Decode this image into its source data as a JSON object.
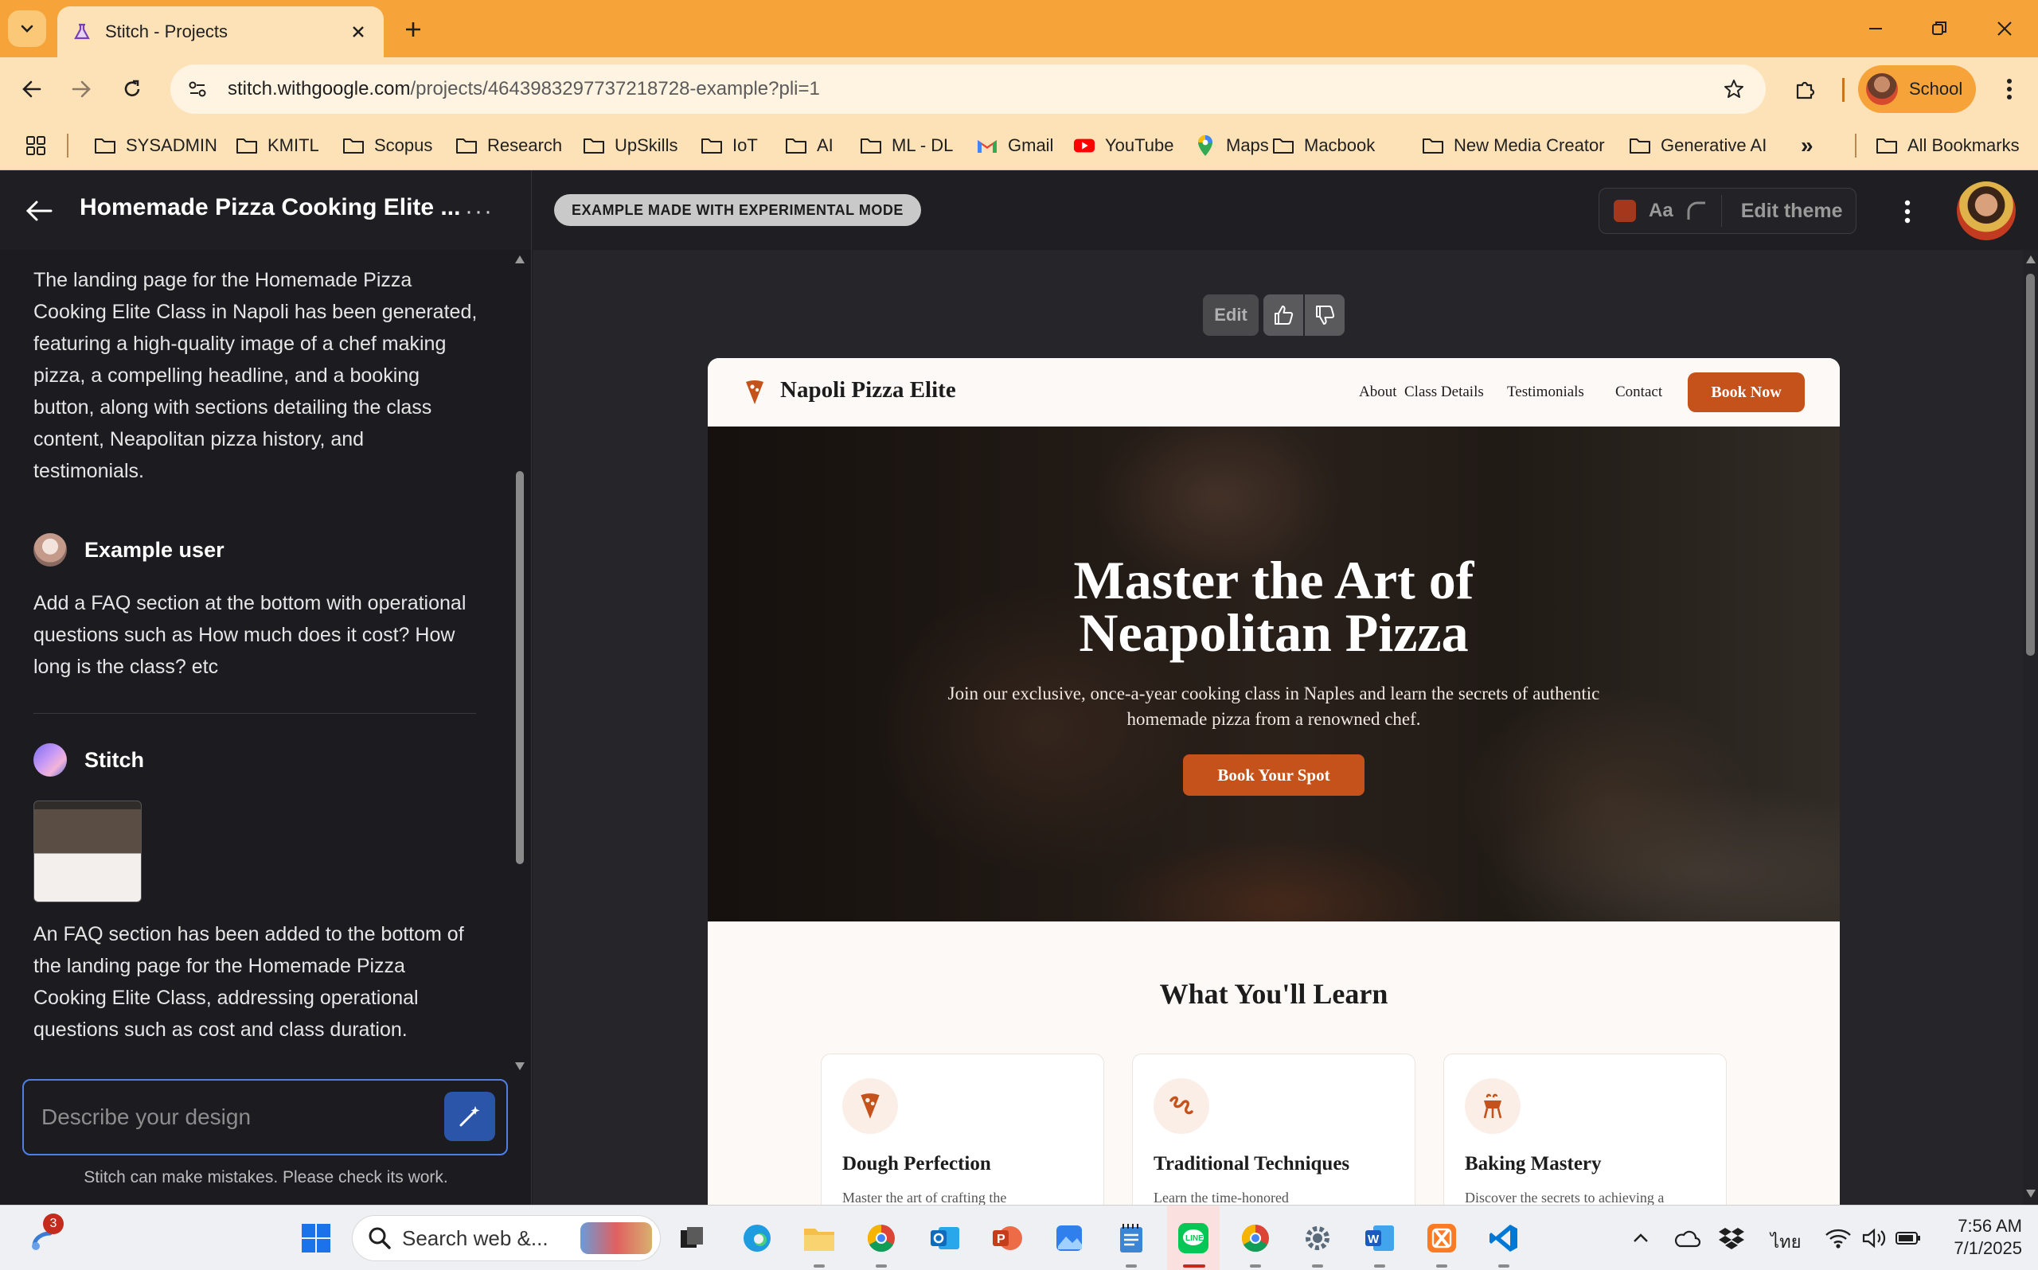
{
  "browser": {
    "tab_title": "Stitch - Projects",
    "url_host": "stitch.withgoogle.com",
    "url_path": "/projects/4643983297737218728-example?pli=1",
    "profile_label": "School",
    "bookmarks": [
      {
        "label": "SYSADMIN",
        "icon": "folder-icon"
      },
      {
        "label": "KMITL",
        "icon": "folder-icon"
      },
      {
        "label": "Scopus",
        "icon": "folder-icon"
      },
      {
        "label": "Research",
        "icon": "folder-icon"
      },
      {
        "label": "UpSkills",
        "icon": "folder-icon"
      },
      {
        "label": "IoT",
        "icon": "folder-icon"
      },
      {
        "label": "AI",
        "icon": "folder-icon"
      },
      {
        "label": "ML - DL",
        "icon": "folder-icon"
      },
      {
        "label": "Gmail",
        "icon": "gmail-icon"
      },
      {
        "label": "YouTube",
        "icon": "youtube-icon"
      },
      {
        "label": "Maps",
        "icon": "maps-icon"
      },
      {
        "label": "Macbook",
        "icon": "folder-icon"
      },
      {
        "label": "New Media Creator",
        "icon": "folder-icon"
      },
      {
        "label": "Generative AI",
        "icon": "folder-icon"
      }
    ],
    "all_bookmarks": "All Bookmarks",
    "overflow": "»"
  },
  "app": {
    "project_title": "Homemade Pizza Cooking Elite ...",
    "more_label": "···",
    "mode_pill": "EXAMPLE MADE WITH EXPERIMENTAL MODE",
    "font_label": "Aa",
    "edit_theme": "Edit theme",
    "accent_color": "#c6521b"
  },
  "chat": {
    "msg1": "The landing page for the Homemade Pizza Cooking Elite Class in Napoli has been generated, featuring a high-quality image of a chef making pizza, a compelling headline, and a booking button, along with sections detailing the class content, Neapolitan pizza history, and testimonials.",
    "user_name": "Example user",
    "msg2": "Add a FAQ section at the bottom with operational questions such as How much does it cost? How long is the class? etc",
    "bot_name": "Stitch",
    "msg3": "An FAQ section has been added to the bottom of the landing page for the Homemade Pizza Cooking Elite Class, addressing operational questions such as cost and class duration.",
    "prompt_placeholder": "Describe your design",
    "disclaimer": "Stitch can make mistakes. Please check its work."
  },
  "canvas": {
    "edit_label": "Edit"
  },
  "preview": {
    "brand": "Napoli Pizza Elite",
    "nav": [
      "About",
      "Class Details",
      "Testimonials",
      "Contact"
    ],
    "book_now": "Book Now",
    "hero_title_line1": "Master the Art of",
    "hero_title_line2": "Neapolitan Pizza",
    "hero_sub": "Join our exclusive, once-a-year cooking class in Naples and learn the secrets of authentic homemade pizza from a renowned chef.",
    "hero_cta": "Book Your Spot",
    "section_title": "What You'll Learn",
    "cards": [
      {
        "title": "Dough Perfection",
        "desc": "Master the art of crafting the",
        "icon": "pizza-slice-icon"
      },
      {
        "title": "Traditional Techniques",
        "desc": "Learn the time-honored",
        "icon": "technique-icon"
      },
      {
        "title": "Baking Mastery",
        "desc": "Discover the secrets to achieving a",
        "icon": "oven-icon"
      }
    ]
  },
  "taskbar": {
    "notification_count": "3",
    "search_placeholder": "Search web &...",
    "language": "ไทย",
    "time": "7:56 AM",
    "date": "7/1/2025"
  }
}
